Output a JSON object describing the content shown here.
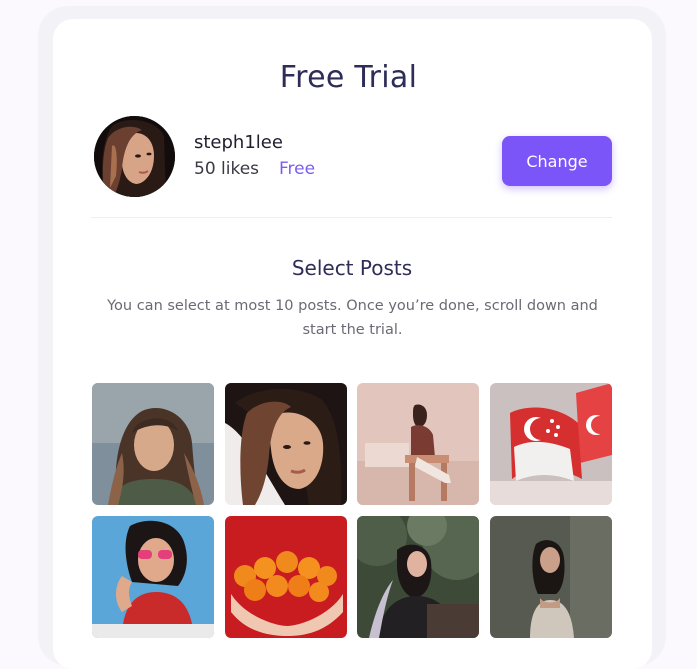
{
  "header": {
    "title": "Free Trial"
  },
  "profile": {
    "username": "steph1lee",
    "likes": "50 likes",
    "plan": "Free",
    "change_label": "Change"
  },
  "select": {
    "title": "Select Posts",
    "description": "You can select at most 10 posts. Once you’re done, scroll down and start the trial."
  },
  "colors": {
    "accent": "#7b55f8",
    "title_text": "#2e2d57"
  },
  "posts": [
    {
      "icon": "photo-portrait-woman"
    },
    {
      "icon": "photo-portrait-closeup"
    },
    {
      "icon": "photo-woman-seated"
    },
    {
      "icon": "photo-singapore-flags"
    },
    {
      "icon": "photo-woman-sunglasses"
    },
    {
      "icon": "photo-oranges-in-hands"
    },
    {
      "icon": "photo-woman-forest"
    },
    {
      "icon": "photo-woman-wall"
    }
  ]
}
